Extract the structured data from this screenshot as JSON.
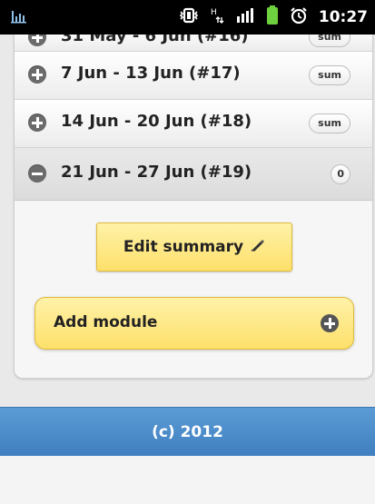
{
  "statusbar": {
    "time": "10:27",
    "icons": [
      "usb-debug-icon",
      "vibrate-icon",
      "hspa-icon",
      "signal-icon",
      "battery-icon",
      "alarm-icon"
    ]
  },
  "weeks": [
    {
      "label": "31 May - 6 Jun (#16)",
      "badge": "sum",
      "state": "collapsed"
    },
    {
      "label": "7 Jun - 13 Jun (#17)",
      "badge": "sum",
      "state": "collapsed"
    },
    {
      "label": "14 Jun - 20 Jun (#18)",
      "badge": "sum",
      "state": "collapsed"
    },
    {
      "label": "21 Jun - 27 Jun (#19)",
      "badge": "0",
      "state": "expanded"
    }
  ],
  "actions": {
    "edit_summary": "Edit summary",
    "add_module": "Add module"
  },
  "footer": {
    "text": "(c) 2012"
  },
  "colors": {
    "accent": "#fde06b",
    "footer": "#4a8ac9",
    "icon": "#6b6b6b"
  }
}
